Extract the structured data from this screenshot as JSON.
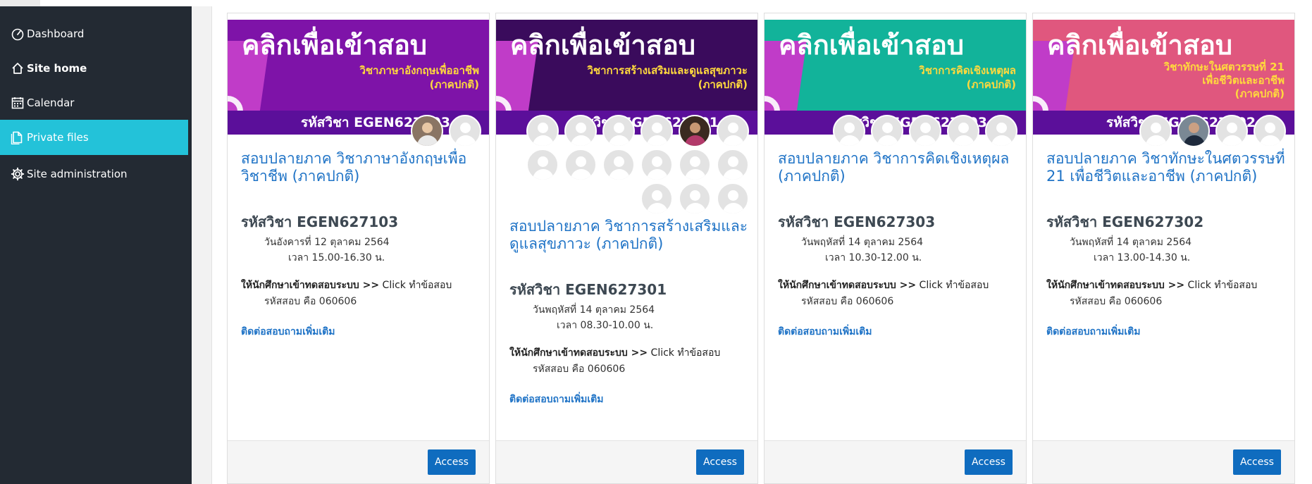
{
  "sidebar": {
    "items": [
      {
        "label": "Dashboard",
        "icon": "dashboard-icon"
      },
      {
        "label": "Site home",
        "icon": "home-icon"
      },
      {
        "label": "Calendar",
        "icon": "calendar-icon"
      },
      {
        "label": "Private files",
        "icon": "file-icon"
      },
      {
        "label": "Site administration",
        "icon": "gear-icon"
      }
    ]
  },
  "cards": [
    {
      "banner_title": "คลิกเพื่อเข้าสอบ",
      "banner_subject_line1": "วิชาภาษาอังกฤษเพื่ออาชีพ",
      "banner_subject_line2": "(ภาคปกติ)",
      "banner_code": "รหัสวิชา EGEN627103",
      "title": "สอบปลายภาค วิชาภาษาอังกฤษเพื่อวิชาชีพ (ภาคปกติ)",
      "code": "รหัสวิชา EGEN627103",
      "date": "วันอังคารที่ 12 ตุลาคม 2564",
      "time": "เวลา 15.00-16.30 น.",
      "instruction_bold": "ให้นักศึกษาเข้าทดสอบระบบ >>",
      "instruction_rest": " Click ทำข้อสอบ",
      "password": "รหัสสอบ คือ 060606",
      "contact": "ติดต่อสอบถามเพิ่มเติม",
      "button": "Access"
    },
    {
      "banner_title": "คลิกเพื่อเข้าสอบ",
      "banner_subject_line1": "วิชาการสร้างเสริมและดูแลสุขภาวะ",
      "banner_subject_line2": "(ภาคปกติ)",
      "banner_code": "รหัสวิชา EGEN627301",
      "title": "สอบปลายภาค วิชาการสร้างเสริมและดูแลสุขภาวะ (ภาคปกติ)",
      "code": "รหัสวิชา EGEN627301",
      "date": "วันพฤหัสที่ 14 ตุลาคม 2564",
      "time": "เวลา 08.30-10.00 น.",
      "instruction_bold": "ให้นักศึกษาเข้าทดสอบระบบ >>",
      "instruction_rest": " Click ทำข้อสอบ",
      "password": "รหัสสอบ คือ 060606",
      "contact": "ติดต่อสอบถามเพิ่มเติม",
      "button": "Access"
    },
    {
      "banner_title": "คลิกเพื่อเข้าสอบ",
      "banner_subject_line1": "วิชาการคิดเชิงเหตุผล",
      "banner_subject_line2": "(ภาคปกติ)",
      "banner_code": "รหัสวิชา EGEN627303",
      "title": "สอบปลายภาค วิชาการคิดเชิงเหตุผล (ภาคปกติ)",
      "code": "รหัสวิชา EGEN627303",
      "date": "วันพฤหัสที่ 14 ตุลาคม 2564",
      "time": "เวลา 10.30-12.00 น.",
      "instruction_bold": "ให้นักศึกษาเข้าทดสอบระบบ >>",
      "instruction_rest": " Click ทำข้อสอบ",
      "password": "รหัสสอบ คือ 060606",
      "contact": "ติดต่อสอบถามเพิ่มเติม",
      "button": "Access"
    },
    {
      "banner_title": "คลิกเพื่อเข้าสอบ",
      "banner_subject_line1": "วิชาทักษะในศตวรรษที่ 21",
      "banner_subject_line2": "เพื่อชีวิตและอาชีพ",
      "banner_subject_line3": "(ภาคปกติ)",
      "banner_code": "รหัสวิชา EGEN627302",
      "title": "สอบปลายภาค วิชาทักษะในศตวรรษที่ 21 เพื่อชีวิตและอาชีพ (ภาคปกติ)",
      "code": "รหัสวิชา EGEN627302",
      "date": "วันพฤหัสที่ 14 ตุลาคม 2564",
      "time": "เวลา 13.00-14.30 น.",
      "instruction_bold": "ให้นักศึกษาเข้าทดสอบระบบ >>",
      "instruction_rest": " Click ทำข้อสอบ",
      "password": "รหัสสอบ คือ 060606",
      "contact": "ติดต่อสอบถามเพิ่มเติม",
      "button": "Access"
    }
  ],
  "colors": {
    "sidebar_bg": "#232a33",
    "sidebar_active": "#23c2d9",
    "link": "#1f73c6",
    "button": "#0f6cbf",
    "banner_purple": "#7e13a8",
    "banner_dark_purple": "#3a0b5c",
    "banner_teal": "#12b39a",
    "banner_pink": "#e0577e",
    "banner_code_bar": "#5b0f9a"
  }
}
